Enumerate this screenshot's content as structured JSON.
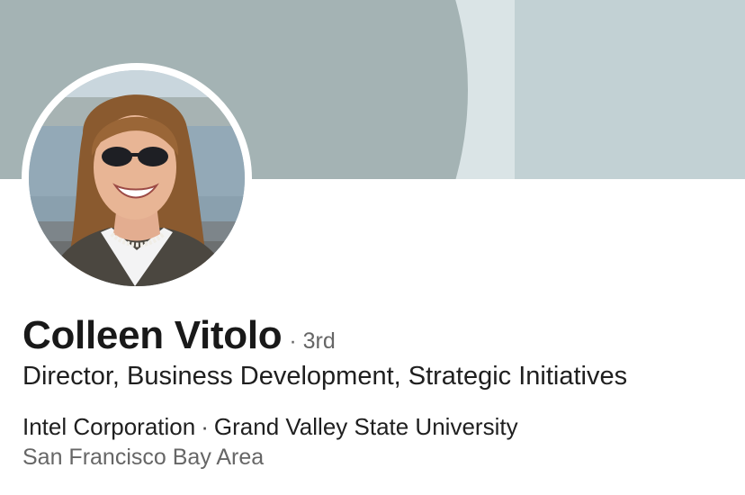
{
  "profile": {
    "name": "Colleen Vitolo",
    "degree_separator": "·",
    "degree": "3rd",
    "headline": "Director, Business Development, Strategic Initiatives",
    "current_company": "Intel Corporation",
    "org_separator": "·",
    "education": "Grand Valley State University",
    "location": "San Francisco Bay Area"
  },
  "colors": {
    "cover_background": "#c2d1d4",
    "cover_shape": "#a4b3b4",
    "cover_band": "#dae4e6",
    "name_text": "#191919",
    "secondary_text": "#666666"
  }
}
